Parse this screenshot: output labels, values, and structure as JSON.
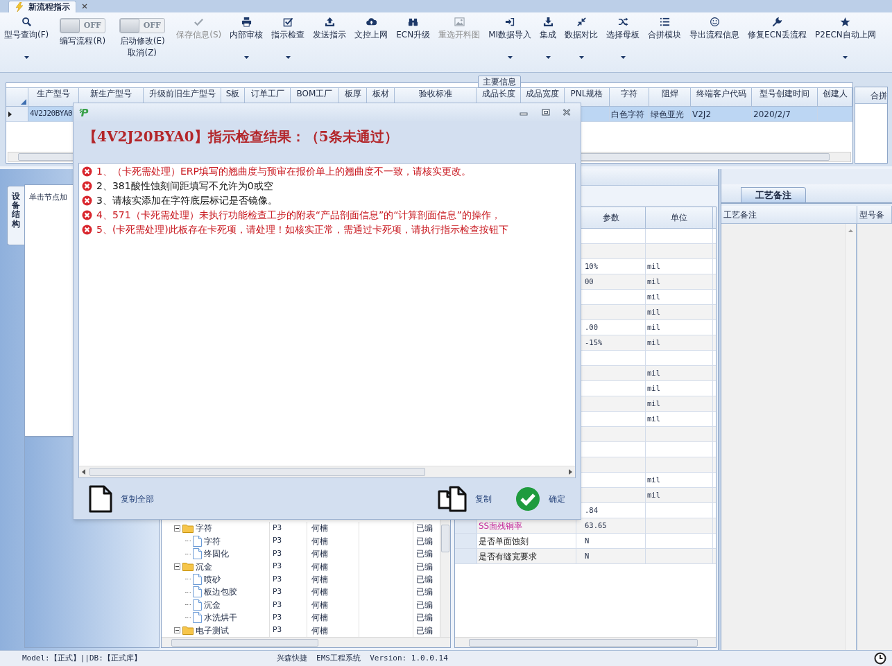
{
  "tab": {
    "title": "新流程指示",
    "selected": true
  },
  "toolbar": [
    {
      "kind": "button",
      "label": "型号查询(F)",
      "disabled": false,
      "dropdown": true
    },
    {
      "kind": "toggle",
      "switch_text": "OFF",
      "on": false,
      "label": "编写流程(R)"
    },
    {
      "kind": "toggle",
      "switch_text": "OFF",
      "on": false,
      "label": "启动修改(E)",
      "label2": "取消(Z)"
    },
    {
      "kind": "button",
      "label": "保存信息(S)",
      "disabled": true,
      "dropdown": false
    },
    {
      "kind": "button",
      "label": "内部审核",
      "disabled": false,
      "dropdown": true
    },
    {
      "kind": "button",
      "label": "指示检查",
      "disabled": false,
      "dropdown": true
    },
    {
      "kind": "button",
      "label": "发送指示",
      "disabled": false,
      "dropdown": false
    },
    {
      "kind": "button",
      "label": "文控上网",
      "disabled": false,
      "dropdown": false
    },
    {
      "kind": "button",
      "label": "ECN升级",
      "disabled": false,
      "dropdown": false
    },
    {
      "kind": "button",
      "label": "重选开料图",
      "disabled": true,
      "dropdown": false
    },
    {
      "kind": "button",
      "label": "MI数据导入",
      "disabled": false,
      "dropdown": true
    },
    {
      "kind": "button",
      "label": "集成",
      "disabled": false,
      "dropdown": true
    },
    {
      "kind": "button",
      "label": "数据对比",
      "disabled": false,
      "dropdown": true
    },
    {
      "kind": "button",
      "label": "选择母板",
      "disabled": false,
      "dropdown": true
    },
    {
      "kind": "button",
      "label": "合拼模块",
      "disabled": false,
      "dropdown": false
    },
    {
      "kind": "button",
      "label": "导出流程信息",
      "disabled": false,
      "dropdown": false
    },
    {
      "kind": "button",
      "label": "修复ECN丢流程",
      "disabled": false,
      "dropdown": false
    },
    {
      "kind": "button",
      "label": "P2ECN自动上网",
      "disabled": false,
      "dropdown": true
    }
  ],
  "main_info": {
    "title": "主要信息",
    "columns": [
      "生产型号",
      "新生产型号",
      "升级前旧生产型号",
      "S板",
      "订单工厂",
      "BOM工厂",
      "板厚",
      "板材",
      "验收标准",
      "成品长度",
      "成品宽度",
      "PNL规格",
      "字符",
      "阻焊",
      "终端客户代码",
      "型号创建时间",
      "创建人"
    ],
    "rows": [
      {
        "selected": true,
        "cells": [
          "4V2J20BYA0",
          null,
          null,
          null,
          null,
          null,
          null,
          null,
          null,
          null,
          null,
          null,
          "白色字符",
          "绿色亚光",
          "V2J2",
          "2020/2/7",
          null
        ]
      }
    ],
    "side_column": "合拼"
  },
  "left_panel": {
    "side_tab": {
      "label": "设备结构",
      "selected": true
    },
    "hint": "单击节点加"
  },
  "process_tree": [
    {
      "name": "字符",
      "kind": "folder",
      "expanded": true,
      "code": "P3",
      "owner": "何楠",
      "status": "已编",
      "children": [
        {
          "name": "字符",
          "kind": "file",
          "code": "P3",
          "owner": "何楠",
          "status": "已编"
        },
        {
          "name": "终固化",
          "kind": "file",
          "code": "P3",
          "owner": "何楠",
          "status": "已编"
        }
      ]
    },
    {
      "name": "沉金",
      "kind": "folder",
      "expanded": true,
      "code": "P3",
      "owner": "何楠",
      "status": "已编",
      "children": [
        {
          "name": "喷砂",
          "kind": "file",
          "code": "P3",
          "owner": "何楠",
          "status": "已编"
        },
        {
          "name": "板边包胶",
          "kind": "file",
          "code": "P3",
          "owner": "何楠",
          "status": "已编"
        },
        {
          "name": "沉金",
          "kind": "file",
          "code": "P3",
          "owner": "何楠",
          "status": "已编"
        },
        {
          "name": "水洗烘干",
          "kind": "file",
          "code": "P3",
          "owner": "何楠",
          "status": "已编"
        }
      ]
    },
    {
      "name": "电子测试",
      "kind": "folder",
      "expanded": true,
      "code": "P3",
      "owner": "何楠",
      "status": "已编"
    }
  ],
  "param_grid": {
    "columns": [
      "参数",
      "单位"
    ],
    "rows": [
      {},
      {},
      {
        "value": "10%",
        "unit": "mil"
      },
      {
        "value": "00",
        "unit": "mil"
      },
      {
        "unit": "mil"
      },
      {
        "unit": "mil"
      },
      {
        "value": ".00",
        "unit": "mil"
      },
      {
        "value": "-15%",
        "unit": "mil"
      },
      {},
      {
        "unit": "mil"
      },
      {
        "unit": "mil"
      },
      {
        "unit": "mil"
      },
      {
        "unit": "mil"
      },
      {},
      {},
      {},
      {
        "unit": "mil"
      },
      {
        "unit": "mil"
      },
      {
        "value": ".84"
      },
      {
        "name": "SS面残铜率",
        "color": "#c4259a",
        "value": "63.65"
      },
      {
        "name": "是否单面蚀刻",
        "value": "N"
      },
      {
        "name": "是否有缝宽要求",
        "value": "N"
      }
    ]
  },
  "notes_panel": {
    "tab": {
      "label": "工艺备注",
      "selected": true
    },
    "columns": [
      "工艺备注",
      "型号备"
    ]
  },
  "status_bar": {
    "left": "Model:【正式】||DB:【正式库】",
    "center": "兴森快捷  EMS工程系统  Version: 1.0.0.14"
  },
  "dialog": {
    "heading": "【4V2J20BYA0】指示检查结果：（5条未通过）",
    "items": [
      {
        "text": "1、（卡死需处理）ERP填写的翘曲度与预审在报价单上的翘曲度不一致，请核实更改。",
        "blocking": true
      },
      {
        "text": "2、381酸性蚀刻间距填写不允许为0或空",
        "blocking": false
      },
      {
        "text": "3、请核实添加在字符底层标记是否镜像。",
        "blocking": false
      },
      {
        "text": "4、571（卡死需处理）未执行功能检查工步的附表“产品剖面信息”的“计算剖面信息”的操作，",
        "blocking": true
      },
      {
        "text": "5、(卡死需处理)此板存在卡死项，请处理！如核实正常，需通过卡死项，请执行指示检查按钮下",
        "blocking": true
      }
    ],
    "buttons": [
      {
        "kind": "copy_all",
        "label": "复制全部"
      },
      {
        "kind": "copy",
        "label": "复制"
      },
      {
        "kind": "ok",
        "label": "确定"
      }
    ]
  }
}
